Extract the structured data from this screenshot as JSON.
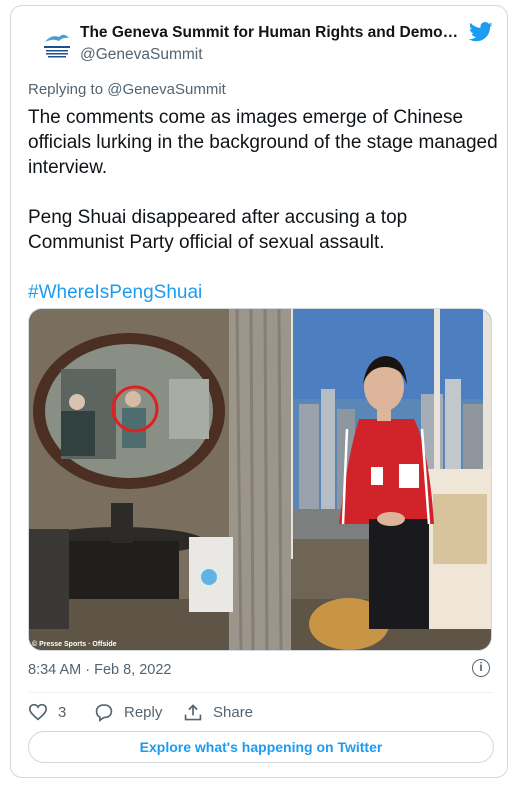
{
  "tweet": {
    "author_name": "The Geneva Summit for Human Rights and Democr...",
    "author_handle": "@GenevaSummit",
    "logo_text": "GENEVA SUMMIT HUMAN RIGHTS DEMOCRACY",
    "reply_prefix": "Replying to ",
    "reply_handle": "@GenevaSummit",
    "paragraph1": "The comments come as images emerge of Chinese officials lurking in the background of the stage managed interview.",
    "paragraph2": "Peng Shuai disappeared after accusing a top Communist Party official of sexual assault.",
    "hashtag": "#WhereIsPengShuai",
    "photo_credit": "© Presse Sports · Offside",
    "timestamp": "8:34 AM · Feb 8, 2022",
    "likes": "3",
    "reply_label": "Reply",
    "share_label": "Share",
    "explore_label": "Explore what's happening on Twitter"
  },
  "colors": {
    "accent": "#1d9bf0",
    "secondary_text": "#536471",
    "border": "#cfd9de",
    "jacket_red": "#d42a2c"
  },
  "icons": [
    "twitter-bird-icon",
    "info-icon",
    "heart-icon",
    "reply-icon",
    "share-icon"
  ]
}
